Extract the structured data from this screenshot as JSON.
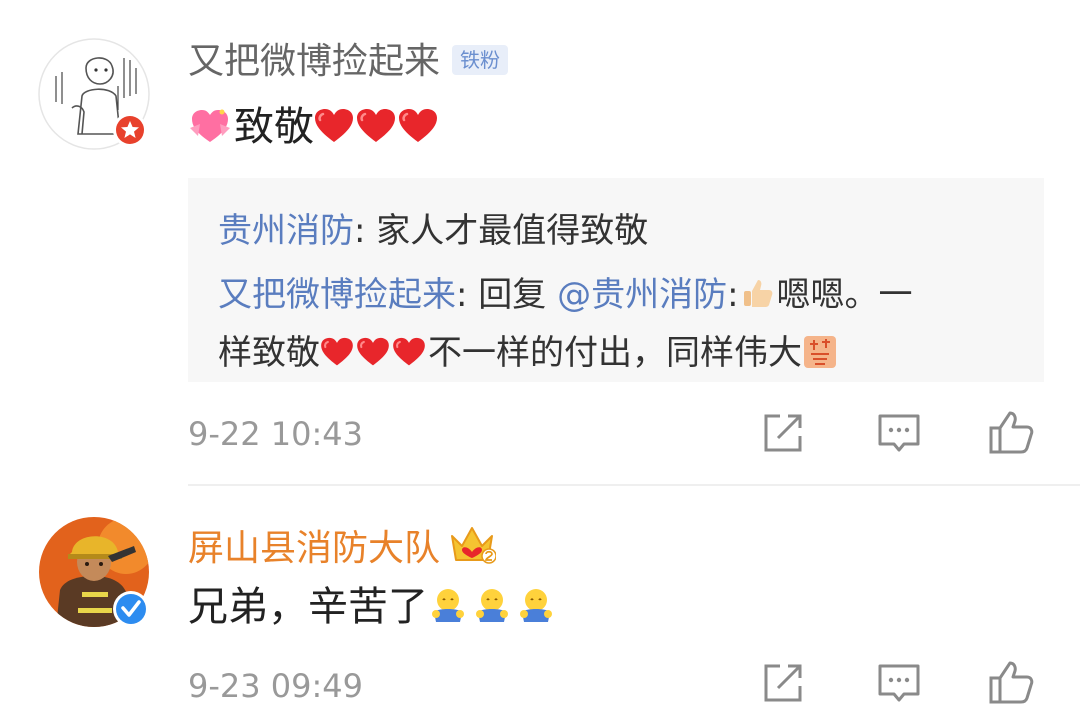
{
  "comments": [
    {
      "username": "又把微博捡起来",
      "badge": "铁粉",
      "text": "致敬",
      "quote": {
        "line1_name": "贵州消防",
        "line1_text": ": 家人才最值得致敬",
        "line2_name": "又把微博捡起来",
        "line2_text": ": 回复 ",
        "line2_mention": "@贵州消防",
        "line2_after": ":",
        "line2_end": "嗯嗯。一",
        "line3_start": "样致敬",
        "line3_mid": "不一样的付出，同样伟大"
      },
      "time": "9-22 10:43"
    },
    {
      "username": "屏山县消防大队",
      "text": "兄弟，辛苦了",
      "time": "9-23 09:49"
    }
  ],
  "icons": {
    "share": "share-icon",
    "comment": "comment-icon",
    "like": "thumbs-up-icon"
  },
  "colors": {
    "username_regular": "#666666",
    "username_vip": "#e8822a",
    "link": "#5a7dbf",
    "heart": "#e8262b",
    "verified": "#2d8cf0"
  }
}
